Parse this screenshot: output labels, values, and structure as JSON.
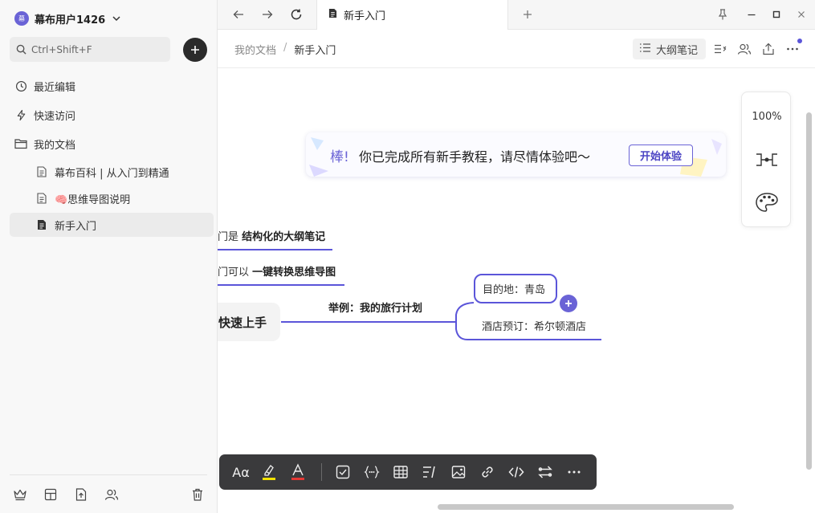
{
  "sidebar": {
    "user_name": "幕布用户1426",
    "avatar_text": "幕",
    "search_placeholder": "Ctrl+Shift+F",
    "items": [
      {
        "label": "最近编辑",
        "icon": "clock-icon"
      },
      {
        "label": "快速访问",
        "icon": "lightning-icon"
      },
      {
        "label": "我的文档",
        "icon": "folder-icon"
      }
    ],
    "docs": [
      {
        "label": "幕布百科 | 从入门到精通",
        "icon": "document-icon"
      },
      {
        "label": "🧠思维导图说明",
        "icon": "document-icon"
      },
      {
        "label": "新手入门",
        "icon": "document-filled-icon",
        "active": true
      }
    ],
    "footer_icons": [
      "crown-icon",
      "template-icon",
      "import-icon",
      "members-icon",
      "trash-icon"
    ]
  },
  "tabbar": {
    "active_tab": "新手入门"
  },
  "header": {
    "breadcrumb_root": "我的文档",
    "breadcrumb_sep": "/",
    "breadcrumb_current": "新手入门",
    "outline_label": "大纲笔记"
  },
  "banner": {
    "emphasis": "棒!",
    "message": "你已完成所有新手教程，请尽情体验吧～",
    "button": "开始体验"
  },
  "side_panel": {
    "zoom": "100%"
  },
  "mindmap": {
    "line1_prefix": "门是",
    "line1_bold": "结构化的大纲笔记",
    "line2_prefix": "门可以",
    "line2_bold": "一键转换思维导图",
    "root": "快速上手",
    "branch": "举例：我的旅行计划",
    "child1": "目的地：青岛",
    "child2": "酒店预订：希尔顿酒店"
  },
  "toolbar": {
    "font_label": "Aα",
    "color_label": "A",
    "accent": "#5b55d9",
    "highlight": "#f2e200",
    "font_color": "#e53935"
  }
}
